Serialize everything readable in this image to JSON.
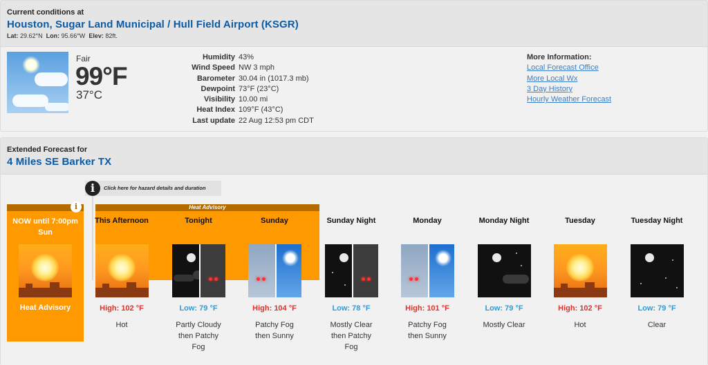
{
  "current": {
    "heading": "Current conditions at",
    "station": "Houston, Sugar Land Municipal / Hull Field Airport (KSGR)",
    "lat_label": "Lat:",
    "lat": "29.62°N",
    "lon_label": "Lon:",
    "lon": "95.66°W",
    "elev_label": "Elev:",
    "elev": "82ft.",
    "condition": "Fair",
    "temp_f": "99°F",
    "temp_c": "37°C",
    "icon": "fair-day-icon",
    "details": [
      {
        "label": "Humidity",
        "value": "43%"
      },
      {
        "label": "Wind Speed",
        "value": "NW 3 mph"
      },
      {
        "label": "Barometer",
        "value": "30.04 in (1017.3 mb)"
      },
      {
        "label": "Dewpoint",
        "value": "73°F (23°C)"
      },
      {
        "label": "Visibility",
        "value": "10.00 mi"
      },
      {
        "label": "Heat Index",
        "value": "109°F (43°C)"
      },
      {
        "label": "Last update",
        "value": "22 Aug 12:53 pm CDT"
      }
    ],
    "more_info": {
      "title": "More Information:",
      "links": [
        "Local Forecast Office",
        "More Local Wx",
        "3 Day History",
        "Hourly Weather Forecast"
      ]
    }
  },
  "forecast": {
    "heading": "Extended Forecast for",
    "location": "4 Miles SE Barker TX",
    "hazard_link": "Click here for hazard details and duration",
    "now": {
      "title": "NOW until 7:00pm Sun",
      "label": "Heat Advisory"
    },
    "advisory_label": "Heat Advisory",
    "colors": {
      "advisory": "#ff9900",
      "advisory_dark": "#b36b00",
      "high": "#e0302a",
      "low": "#2d9ad9"
    },
    "periods": [
      {
        "name": "This Afternoon",
        "temp": "High: 102 °F",
        "kind": "high",
        "desc": "Hot",
        "icon": "hot-icon"
      },
      {
        "name": "Tonight",
        "temp": "Low: 79 °F",
        "kind": "low",
        "desc": "Partly Cloudy then Patchy Fog",
        "icon": "partly-cloudy-fog-night-icon"
      },
      {
        "name": "Sunday",
        "temp": "High: 104 °F",
        "kind": "high",
        "desc": "Patchy Fog then Sunny",
        "icon": "fog-sunny-icon"
      },
      {
        "name": "Sunday Night",
        "temp": "Low: 78 °F",
        "kind": "low",
        "desc": "Mostly Clear then Patchy Fog",
        "icon": "clear-fog-night-icon"
      },
      {
        "name": "Monday",
        "temp": "High: 101 °F",
        "kind": "high",
        "desc": "Patchy Fog then Sunny",
        "icon": "fog-sunny-icon"
      },
      {
        "name": "Monday Night",
        "temp": "Low: 79 °F",
        "kind": "low",
        "desc": "Mostly Clear",
        "icon": "mostly-clear-night-icon"
      },
      {
        "name": "Tuesday",
        "temp": "High: 102 °F",
        "kind": "high",
        "desc": "Hot",
        "icon": "hot-icon"
      },
      {
        "name": "Tuesday Night",
        "temp": "Low: 79 °F",
        "kind": "low",
        "desc": "Clear",
        "icon": "clear-night-icon"
      }
    ]
  }
}
